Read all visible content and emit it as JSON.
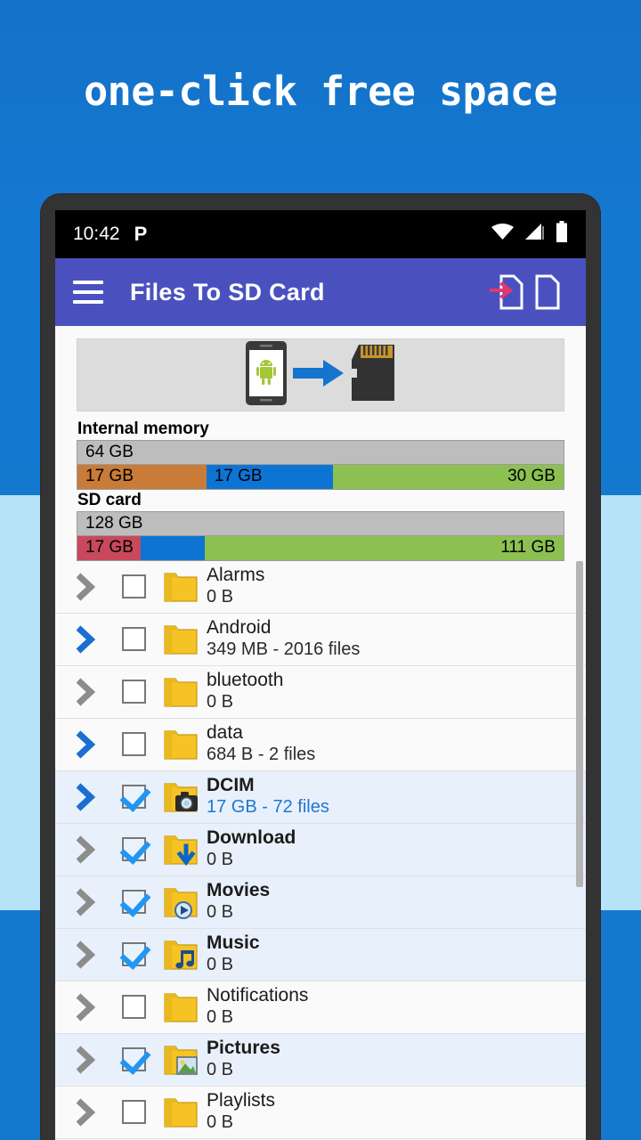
{
  "headline": "one-click free space",
  "colors": {
    "page_bg": "#1478CE",
    "band_bg": "#B6E3F8",
    "appbar": "#4A51BF",
    "accent_blue": "#1E77D3",
    "bar_total": "#BDBDBD",
    "bar_orange": "#C97B37",
    "bar_blue": "#0D74D4",
    "bar_green": "#8CC152",
    "bar_red": "#C9485B",
    "selected_row": "#E8F0FB",
    "folder_yellow": "#F6C324"
  },
  "statusbar": {
    "time": "10:42",
    "app_icon": "P",
    "icons": [
      "wifi-icon",
      "cell-signal-icon",
      "battery-icon"
    ]
  },
  "appbar": {
    "menu_icon": "hamburger-menu-icon",
    "title": "Files To SD Card",
    "actions": [
      {
        "name": "move-files-icon",
        "label": "Move files"
      },
      {
        "name": "new-file-icon",
        "label": "New file"
      }
    ]
  },
  "banner": {
    "from_icon": "android-phone-icon",
    "arrow_icon": "right-arrow-icon",
    "to_icon": "sd-card-icon"
  },
  "storage": [
    {
      "label": "Internal memory",
      "total": "64 GB",
      "segments": [
        {
          "label": "17 GB",
          "color": "#C97B37",
          "percent": 26.5,
          "align": "left"
        },
        {
          "label": "17 GB",
          "color": "#0D74D4",
          "percent": 26.0,
          "align": "left"
        },
        {
          "label": "30 GB",
          "color": "#8CC152",
          "percent": 47.5,
          "align": "right"
        }
      ]
    },
    {
      "label": "SD card",
      "total": "128 GB",
      "segments": [
        {
          "label": "17 GB",
          "color": "#C9485B",
          "percent": 13.0,
          "align": "left"
        },
        {
          "label": "",
          "color": "#0D74D4",
          "percent": 13.2,
          "align": "left"
        },
        {
          "label": "111 GB",
          "color": "#8CC152",
          "percent": 73.8,
          "align": "right"
        }
      ]
    }
  ],
  "files": [
    {
      "name": "Alarms",
      "meta": "0 B",
      "checked": false,
      "bold": false,
      "chevron": "gray",
      "icon": "folder-icon",
      "meta_blue": false
    },
    {
      "name": "Android",
      "meta": "349 MB - 2016 files",
      "checked": false,
      "bold": false,
      "chevron": "blue",
      "icon": "folder-icon",
      "meta_blue": false
    },
    {
      "name": "bluetooth",
      "meta": "0 B",
      "checked": false,
      "bold": false,
      "chevron": "gray",
      "icon": "folder-icon",
      "meta_blue": false
    },
    {
      "name": "data",
      "meta": "684 B - 2 files",
      "checked": false,
      "bold": false,
      "chevron": "blue",
      "icon": "folder-icon",
      "meta_blue": false
    },
    {
      "name": "DCIM",
      "meta": "17 GB - 72 files",
      "checked": true,
      "bold": true,
      "chevron": "blue",
      "icon": "folder-camera-icon",
      "meta_blue": true
    },
    {
      "name": "Download",
      "meta": "0 B",
      "checked": true,
      "bold": true,
      "chevron": "gray",
      "icon": "folder-download-icon",
      "meta_blue": false
    },
    {
      "name": "Movies",
      "meta": "0 B",
      "checked": true,
      "bold": true,
      "chevron": "gray",
      "icon": "folder-movie-icon",
      "meta_blue": false
    },
    {
      "name": "Music",
      "meta": "0 B",
      "checked": true,
      "bold": true,
      "chevron": "gray",
      "icon": "folder-music-icon",
      "meta_blue": false
    },
    {
      "name": "Notifications",
      "meta": "0 B",
      "checked": false,
      "bold": false,
      "chevron": "gray",
      "icon": "folder-icon",
      "meta_blue": false
    },
    {
      "name": "Pictures",
      "meta": "0 B",
      "checked": true,
      "bold": true,
      "chevron": "gray",
      "icon": "folder-picture-icon",
      "meta_blue": false
    },
    {
      "name": "Playlists",
      "meta": "0 B",
      "checked": false,
      "bold": false,
      "chevron": "gray",
      "icon": "folder-icon",
      "meta_blue": false
    }
  ]
}
